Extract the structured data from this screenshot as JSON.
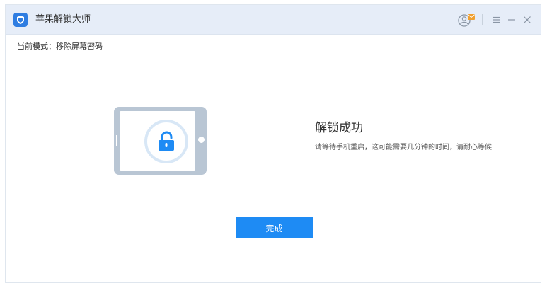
{
  "app": {
    "title": "苹果解锁大师",
    "logo_icon": "shield-icon"
  },
  "window_controls": {
    "account_icon": "user-mail-icon",
    "menu_icon": "hamburger-menu-icon",
    "minimize_icon": "minimize-icon",
    "close_icon": "close-icon"
  },
  "mode": {
    "label": "当前模式：移除屏幕密码"
  },
  "illustration": {
    "device_icon": "tablet-icon",
    "lock_icon": "unlocked-padlock-icon"
  },
  "result": {
    "title": "解锁成功",
    "description": "请等待手机重启，这可能需要几分钟的时间，请耐心等候"
  },
  "actions": {
    "done_label": "完成"
  },
  "colors": {
    "accent": "#1e8bf4",
    "titlebar_bg": "#e6edf8",
    "device": "#b9c6d4",
    "ring": "#d8e7f6"
  }
}
